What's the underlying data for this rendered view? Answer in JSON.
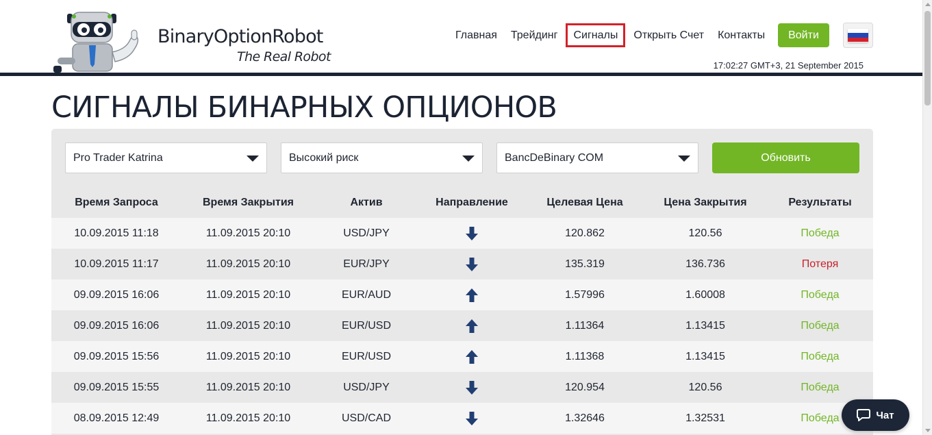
{
  "brand": {
    "name": "BinaryOptionRobot",
    "tagline": "The Real Robot"
  },
  "nav": {
    "items": [
      {
        "label": "Главная"
      },
      {
        "label": "Трейдинг"
      },
      {
        "label": "Сигналы",
        "active": true
      },
      {
        "label": "Открыть Счет"
      },
      {
        "label": "Контакты"
      }
    ],
    "login_label": "Войти",
    "language_flag": "russia-flag-icon"
  },
  "header": {
    "datetime": "17:02:27 GMT+3, 21 September 2015"
  },
  "page_title": "СИГНАЛЫ БИНАРНЫХ ОПЦИОНОВ",
  "filters": {
    "trader": "Pro Trader Katrina",
    "risk": "Высокий риск",
    "broker": "BancDeBinary COM",
    "refresh_label": "Обновить"
  },
  "table": {
    "headers": [
      "Время Запроса",
      "Время Закрытия",
      "Актив",
      "Направление",
      "Целевая Цена",
      "Цена Закрытия",
      "Результаты"
    ],
    "rows": [
      {
        "request_time": "10.09.2015 11:18",
        "close_time": "11.09.2015 20:10",
        "asset": "USD/JPY",
        "direction": "down",
        "target_price": "120.862",
        "close_price": "120.56",
        "result": "Победа",
        "result_type": "win"
      },
      {
        "request_time": "10.09.2015 11:17",
        "close_time": "11.09.2015 20:10",
        "asset": "EUR/JPY",
        "direction": "down",
        "target_price": "135.319",
        "close_price": "136.736",
        "result": "Потеря",
        "result_type": "loss"
      },
      {
        "request_time": "09.09.2015 16:06",
        "close_time": "11.09.2015 20:10",
        "asset": "EUR/AUD",
        "direction": "up",
        "target_price": "1.57996",
        "close_price": "1.60008",
        "result": "Победа",
        "result_type": "win"
      },
      {
        "request_time": "09.09.2015 16:06",
        "close_time": "11.09.2015 20:10",
        "asset": "EUR/USD",
        "direction": "up",
        "target_price": "1.11364",
        "close_price": "1.13415",
        "result": "Победа",
        "result_type": "win"
      },
      {
        "request_time": "09.09.2015 15:56",
        "close_time": "11.09.2015 20:10",
        "asset": "EUR/USD",
        "direction": "up",
        "target_price": "1.11368",
        "close_price": "1.13415",
        "result": "Победа",
        "result_type": "win"
      },
      {
        "request_time": "09.09.2015 15:55",
        "close_time": "11.09.2015 20:10",
        "asset": "USD/JPY",
        "direction": "down",
        "target_price": "120.954",
        "close_price": "120.56",
        "result": "Победа",
        "result_type": "win"
      },
      {
        "request_time": "08.09.2015 12:49",
        "close_time": "11.09.2015 20:10",
        "asset": "USD/CAD",
        "direction": "down",
        "target_price": "1.32646",
        "close_price": "1.32531",
        "result": "Победа",
        "result_type": "win"
      }
    ]
  },
  "chat": {
    "label": "Чат"
  },
  "colors": {
    "accent_green": "#72b626",
    "loss_red": "#c8202b",
    "navy": "#1b2333",
    "arrow_blue": "#223f73"
  }
}
